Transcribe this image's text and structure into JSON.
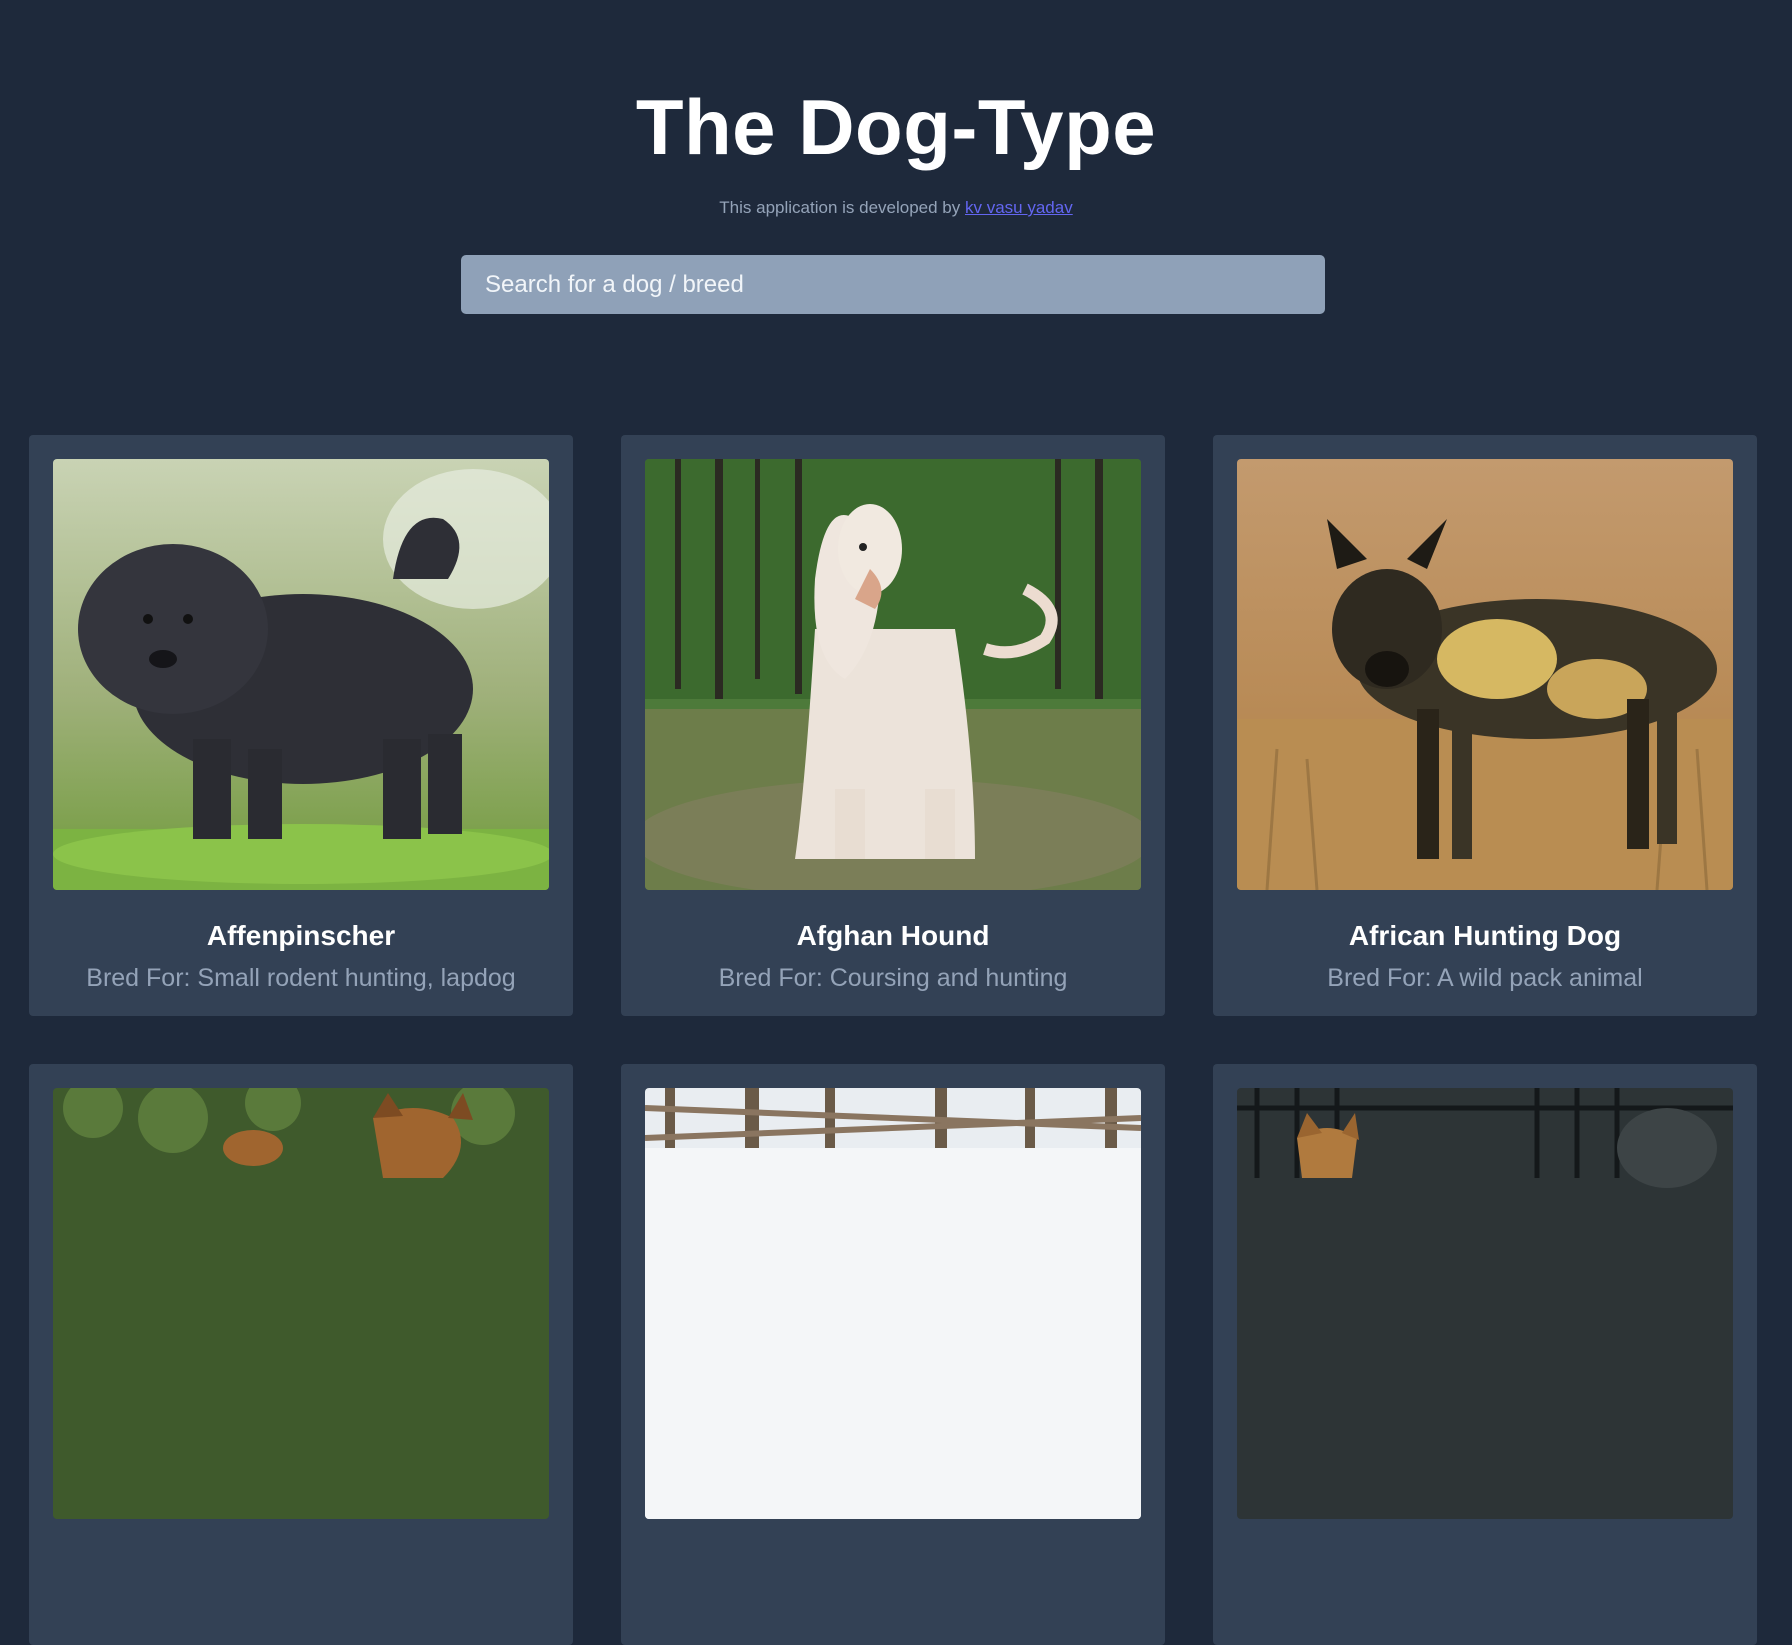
{
  "header": {
    "title": "The Dog-Type",
    "credit_prefix": "This application is developed by ",
    "credit_link": "kv vasu yadav"
  },
  "search": {
    "placeholder": "Search for a dog / breed"
  },
  "cards": [
    {
      "name": "Affenpinscher",
      "bred_for": "Bred For: Small rodent hunting, lapdog"
    },
    {
      "name": "Afghan Hound",
      "bred_for": "Bred For: Coursing and hunting"
    },
    {
      "name": "African Hunting Dog",
      "bred_for": "Bred For: A wild pack animal"
    },
    {
      "name": "",
      "bred_for": ""
    },
    {
      "name": "",
      "bred_for": ""
    },
    {
      "name": "",
      "bred_for": ""
    }
  ],
  "colors": {
    "background": "#1e293b",
    "card": "#334155",
    "search_bg": "#8fa1b8",
    "link": "#6366f1",
    "muted_text": "#94a3b8"
  }
}
